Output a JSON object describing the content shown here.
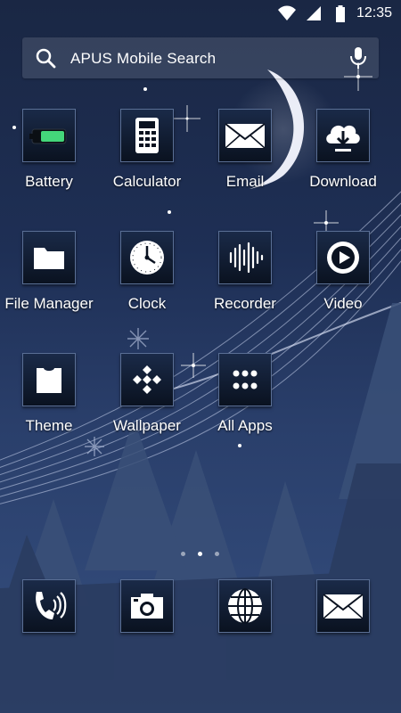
{
  "status_bar": {
    "time": "12:35",
    "icons": [
      "wifi-icon",
      "cell-signal-icon",
      "battery-icon"
    ]
  },
  "search": {
    "placeholder": "APUS Mobile Search"
  },
  "apps": [
    {
      "label": "Battery",
      "icon": "battery-icon"
    },
    {
      "label": "Calculator",
      "icon": "calculator-icon"
    },
    {
      "label": "Email",
      "icon": "envelope-icon"
    },
    {
      "label": "Download",
      "icon": "cloud-download-icon"
    },
    {
      "label": "File Manager",
      "icon": "folder-icon"
    },
    {
      "label": "Clock",
      "icon": "clock-icon"
    },
    {
      "label": "Recorder",
      "icon": "waveform-icon"
    },
    {
      "label": "Video",
      "icon": "play-icon"
    },
    {
      "label": "Theme",
      "icon": "shirt-icon"
    },
    {
      "label": "Wallpaper",
      "icon": "wallpaper-icon"
    },
    {
      "label": "All Apps",
      "icon": "grid-icon"
    }
  ],
  "page_indicator": {
    "count": 3,
    "active_index": 1
  },
  "dock": [
    {
      "icon": "phone-icon"
    },
    {
      "icon": "camera-icon"
    },
    {
      "icon": "globe-icon"
    },
    {
      "icon": "message-icon"
    }
  ]
}
